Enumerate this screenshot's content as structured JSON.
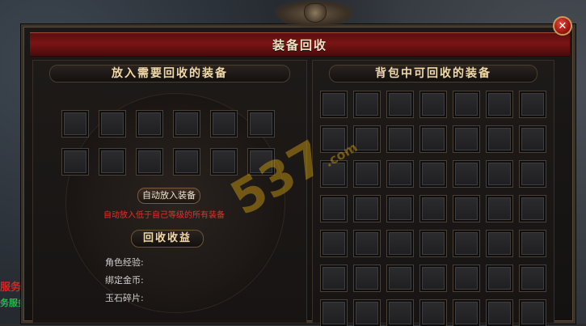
{
  "background": {
    "left_text_1": "服务",
    "left_text_2": "务服务"
  },
  "window": {
    "title": "装备回收",
    "close_label": "✕"
  },
  "left_panel": {
    "header": "放入需要回收的装备",
    "auto_button": "自动放入装备",
    "auto_hint": "自动放入低于自己等级的所有装备",
    "earnings_header": "回收收益",
    "earnings": [
      {
        "label": "角色经验:"
      },
      {
        "label": "绑定金币:"
      },
      {
        "label": "玉石碎片:"
      }
    ],
    "input_slot_count": 12
  },
  "right_panel": {
    "header": "背包中可回收的装备",
    "slot_rows": 7,
    "slot_cols": 7
  },
  "watermark": {
    "text": "537",
    "suffix": ".com"
  },
  "colors": {
    "title_bar": "#7a1414",
    "hint_red": "#e2332a",
    "header_text": "#f0d8a8",
    "watermark": "#d7a410"
  }
}
